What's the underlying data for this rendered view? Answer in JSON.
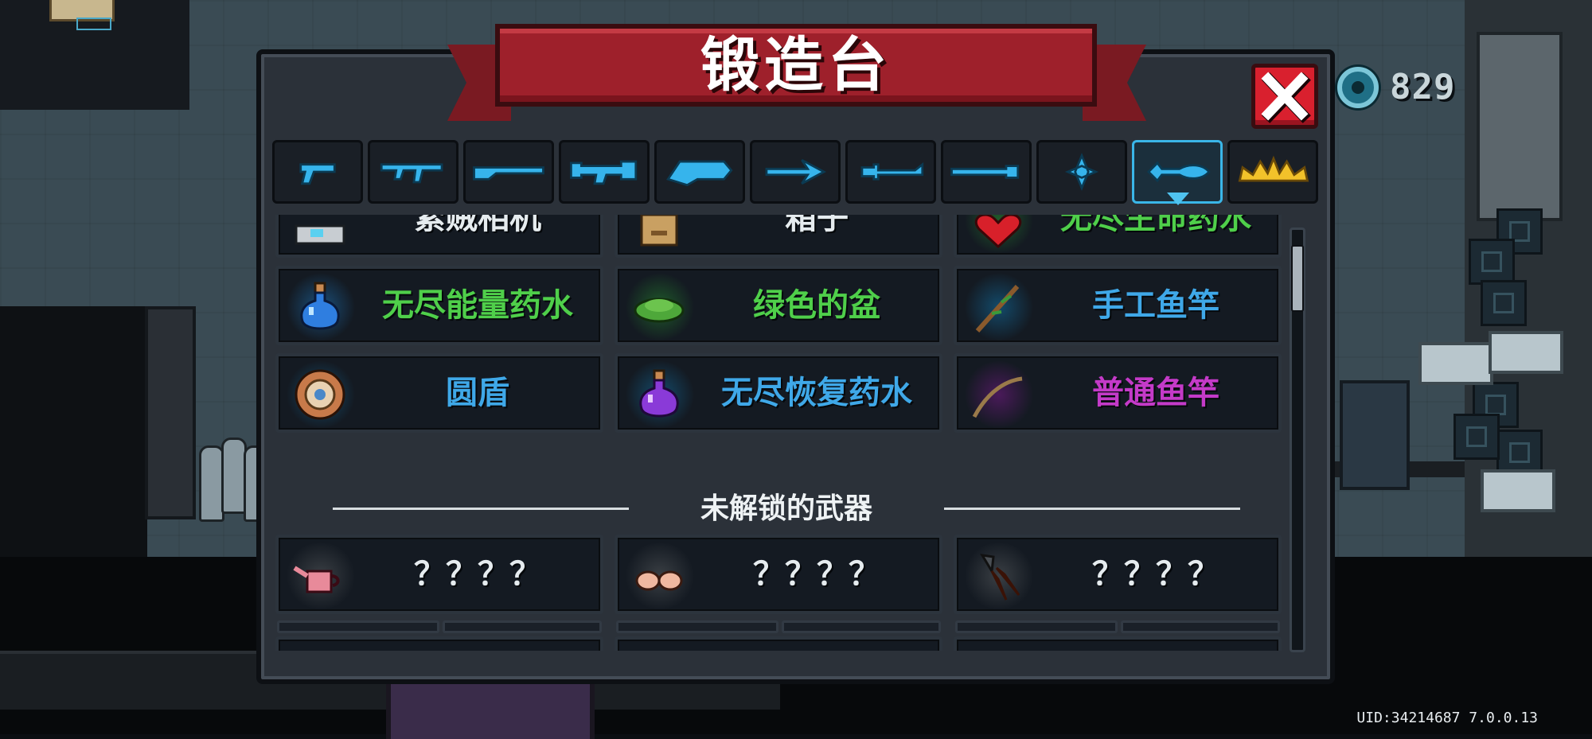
{
  "header": {
    "title": "锻造台"
  },
  "hud": {
    "gem_count": "829",
    "uid": "UID:34214687 7.0.0.13"
  },
  "tabs": [
    {
      "icon": "pistol-icon"
    },
    {
      "icon": "assault-rifle-icon"
    },
    {
      "icon": "shotgun-icon"
    },
    {
      "icon": "heavy-gun-icon"
    },
    {
      "icon": "bow-icon"
    },
    {
      "icon": "spear-icon"
    },
    {
      "icon": "sword-icon"
    },
    {
      "icon": "staff-icon"
    },
    {
      "icon": "shuriken-icon"
    },
    {
      "icon": "fish-icon",
      "active": true
    },
    {
      "icon": "crown-icon"
    }
  ],
  "items": {
    "partial_row": [
      {
        "name": "紧贼相机",
        "icon": "camera-icon"
      },
      {
        "name": "箱子",
        "icon": "box-icon"
      },
      {
        "name": "无尽生命药水",
        "icon": "heart-potion-icon"
      }
    ],
    "rows": [
      [
        {
          "name": "无尽能量药水",
          "color": "#4fcf4a",
          "icon": "blue-potion-icon",
          "glow": "#1a4f7a"
        },
        {
          "name": "绿色的盆",
          "color": "#4fcf4a",
          "icon": "green-basin-icon",
          "glow": "#1f5a2a"
        },
        {
          "name": "手工鱼竿",
          "color": "#3fa8e8",
          "icon": "handmade-rod-icon",
          "glow": "#134a6a"
        }
      ],
      [
        {
          "name": "圆盾",
          "color": "#3fa8e8",
          "icon": "round-shield-icon",
          "glow": "#134a6a"
        },
        {
          "name": "无尽恢复药水",
          "color": "#3fa8e8",
          "icon": "purple-potion-icon",
          "glow": "#134a6a"
        },
        {
          "name": "普通鱼竿",
          "color": "#c43ac8",
          "icon": "common-rod-icon",
          "glow": "#4a1a5a"
        }
      ]
    ]
  },
  "locked_section": {
    "title": "未解锁的武器",
    "items": [
      {
        "name": "？？？？",
        "icon": "watering-can-icon"
      },
      {
        "name": "？？？？",
        "icon": "fists-icon"
      },
      {
        "name": "？？？？",
        "icon": "flame-claw-icon"
      }
    ]
  },
  "colors": {
    "accent": "#3ab6e8",
    "banner": "#9e202b",
    "close": "#d9202e"
  }
}
